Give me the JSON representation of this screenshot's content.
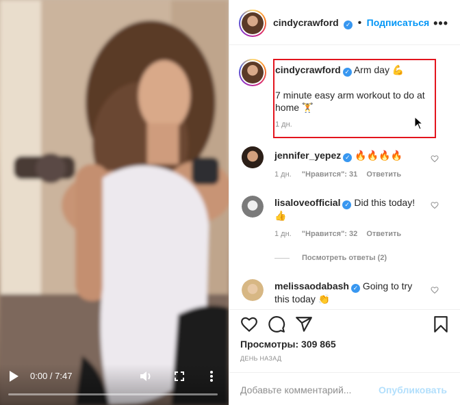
{
  "video": {
    "time": "0:00 / 7:47",
    "progress": 0.0,
    "controls": {
      "play": "play-icon",
      "volume": "volume-icon",
      "fullscreen": "fullscreen-icon",
      "more": "more-vertical-icon"
    }
  },
  "header": {
    "username": "cindycrawford",
    "separator": "•",
    "follow_label": "Подписаться",
    "more": "•••"
  },
  "caption": {
    "username": "cindycrawford",
    "title": "Arm day",
    "title_emoji": "💪",
    "body": "7 minute easy arm workout to do at home",
    "body_emoji": "🏋",
    "time": "1 дн."
  },
  "comments": [
    {
      "username": "jennifer_yepez",
      "text": "🔥🔥🔥🔥",
      "time": "1 дн.",
      "likes": "\"Нравится\": 31",
      "reply": "Ответить"
    },
    {
      "username": "lisaloveofficial",
      "text": "Did this today!",
      "emoji": "👍",
      "time": "1 дн.",
      "likes": "\"Нравится\": 32",
      "reply": "Ответить"
    },
    {
      "username": "melissaodabash",
      "text": "Going to try",
      "text2": "this today",
      "emoji": "👏"
    }
  ],
  "view_replies": "Посмотреть ответы (2)",
  "views_label": "Просмотры: 309 865",
  "posted_ago": "ДЕНЬ НАЗАД",
  "add_comment": {
    "placeholder": "Добавьте комментарий...",
    "publish": "Опубликовать"
  },
  "colors": {
    "accent": "#0095f6",
    "verified": "#3897f0",
    "highlight_box": "#e3141d",
    "muted": "#8e8e8e"
  }
}
